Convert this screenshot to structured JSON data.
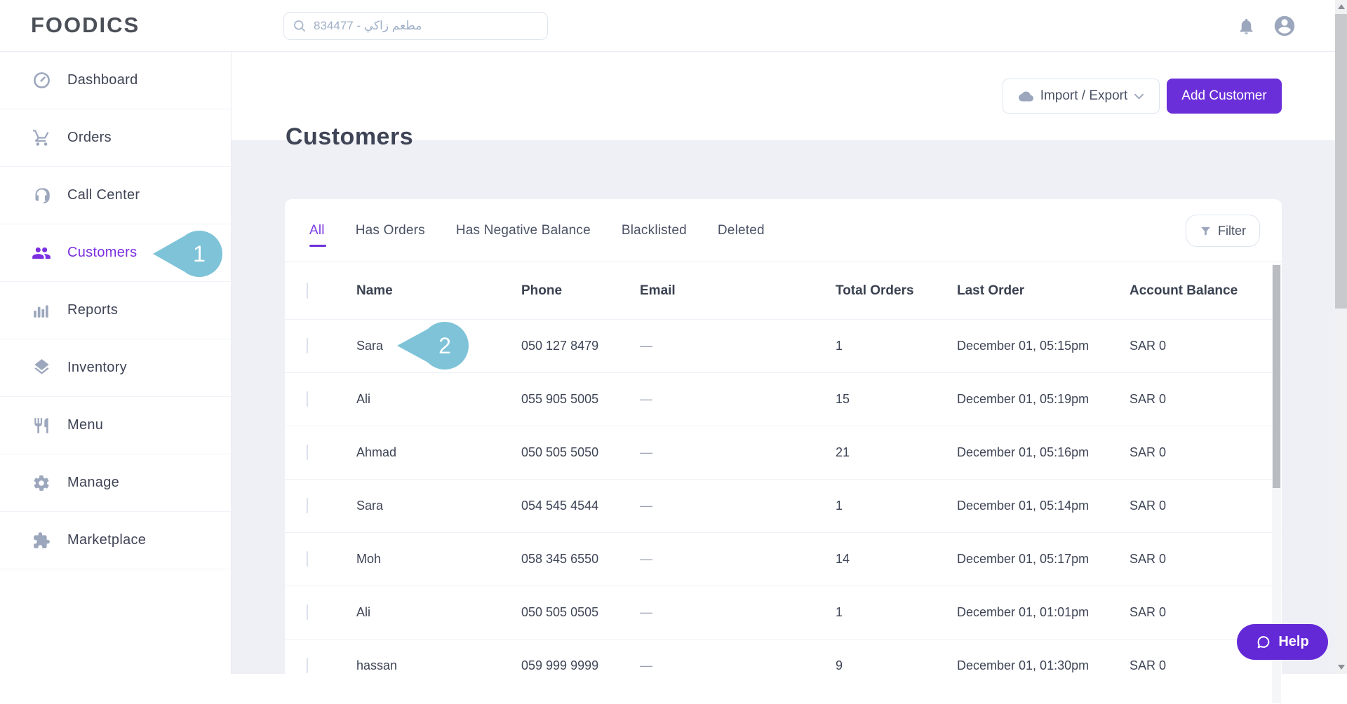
{
  "brand": {
    "logo": "FOODICS"
  },
  "topbar": {
    "search_value": "834477 - مطعم زاكي",
    "icons": [
      "search-icon",
      "bell-icon",
      "avatar-icon"
    ]
  },
  "sidebar": {
    "items": [
      {
        "label": "Dashboard",
        "icon": "gauge-icon",
        "active": false
      },
      {
        "label": "Orders",
        "icon": "cart-icon",
        "active": false
      },
      {
        "label": "Call Center",
        "icon": "headset-icon",
        "active": false
      },
      {
        "label": "Customers",
        "icon": "people-icon",
        "active": true
      },
      {
        "label": "Reports",
        "icon": "bar-chart-icon",
        "active": false
      },
      {
        "label": "Inventory",
        "icon": "layers-icon",
        "active": false
      },
      {
        "label": "Menu",
        "icon": "cutlery-icon",
        "active": false
      },
      {
        "label": "Manage",
        "icon": "gear-icon",
        "active": false
      },
      {
        "label": "Marketplace",
        "icon": "puzzle-icon",
        "active": false
      }
    ]
  },
  "page": {
    "title": "Customers",
    "import_export_label": "Import / Export",
    "add_customer_label": "Add Customer",
    "filter_label": "Filter",
    "help_label": "Help"
  },
  "tabs": {
    "active": "All",
    "items": [
      {
        "label": "All"
      },
      {
        "label": "Has Orders"
      },
      {
        "label": "Has Negative Balance"
      },
      {
        "label": "Blacklisted"
      },
      {
        "label": "Deleted"
      }
    ]
  },
  "table": {
    "columns": [
      "Name",
      "Phone",
      "Email",
      "Total Orders",
      "Last Order",
      "Account Balance"
    ],
    "rows": [
      {
        "name": "Sara",
        "phone": "050 127 8479",
        "email": "—",
        "total_orders": "1",
        "last_order": "December 01, 05:15pm",
        "balance": "SAR 0"
      },
      {
        "name": "Ali",
        "phone": "055 905 5005",
        "email": "—",
        "total_orders": "15",
        "last_order": "December 01, 05:19pm",
        "balance": "SAR 0"
      },
      {
        "name": "Ahmad",
        "phone": "050 505 5050",
        "email": "—",
        "total_orders": "21",
        "last_order": "December 01, 05:16pm",
        "balance": "SAR 0"
      },
      {
        "name": "Sara",
        "phone": "054 545 4544",
        "email": "—",
        "total_orders": "1",
        "last_order": "December 01, 05:14pm",
        "balance": "SAR 0"
      },
      {
        "name": "Moh",
        "phone": "058 345 6550",
        "email": "—",
        "total_orders": "14",
        "last_order": "December 01, 05:17pm",
        "balance": "SAR 0"
      },
      {
        "name": "Ali",
        "phone": "050 505 0505",
        "email": "—",
        "total_orders": "1",
        "last_order": "December 01, 01:01pm",
        "balance": "SAR 0"
      },
      {
        "name": "hassan",
        "phone": "059 999 9999",
        "email": "—",
        "total_orders": "9",
        "last_order": "December 01, 01:30pm",
        "balance": "SAR 0"
      }
    ]
  },
  "annotations": {
    "badge_1": "1",
    "badge_2": "2"
  },
  "colors": {
    "accent_purple": "#6B2FD9",
    "active_purple": "#7B2FE0",
    "icon_gray": "#9CA7BD",
    "annotation_teal": "#7EC3D8",
    "page_bg": "#EEF0F6",
    "border": "#E9EDF3"
  }
}
